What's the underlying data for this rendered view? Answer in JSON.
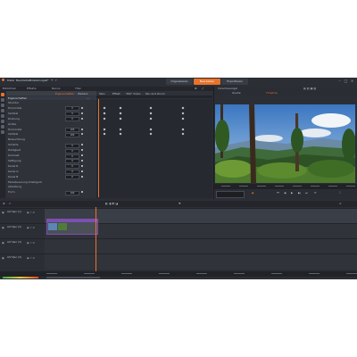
{
  "menu": [
    "Datei",
    "Bearbeiten",
    "Einstellungen"
  ],
  "modes": {
    "organize": "Organisieren",
    "edit": "Bearbeiten",
    "export": "Exportieren"
  },
  "toolbar": {
    "tabs": [
      "Bibliothek",
      "Effekte",
      "Nanos",
      "Titel"
    ]
  },
  "effects_panel": {
    "tabs": [
      "Eigenschaften",
      "Weitere Editor"
    ],
    "header": "Eigenschaften",
    "rows": [
      {
        "label": "Struktur"
      },
      {
        "label": "Horizontal",
        "value": "0"
      },
      {
        "label": "Vertikal",
        "value": "0"
      },
      {
        "label": "Drehung",
        "value": "0"
      },
      {
        "label": "Größe"
      },
      {
        "label": "Horizontal",
        "value": "100"
      },
      {
        "label": "Vertikal",
        "value": "100"
      },
      {
        "label": "Beleuchtung"
      },
      {
        "label": "Schärfe",
        "value": "0"
      },
      {
        "label": "Helligkeit",
        "value": "0"
      },
      {
        "label": "Kontrast",
        "value": "0"
      },
      {
        "label": "Sättigung",
        "value": "0"
      },
      {
        "label": "Kanal R",
        "value": "0"
      },
      {
        "label": "Kanal G",
        "value": "0"
      },
      {
        "label": "Kanal B",
        "value": "0"
      },
      {
        "label": "Farbsteuerung Intelligent"
      },
      {
        "label": "Abbildung"
      },
      {
        "label": "Form",
        "value": "100"
      }
    ]
  },
  "keyframes": {
    "columns": [
      "Tabs",
      "Effekt",
      "360° Video",
      "Pan and Zoom"
    ]
  },
  "preview": {
    "title": "Vorschauvogel",
    "tabs": [
      "Quelle",
      "Timeline"
    ]
  },
  "timeline": {
    "tracks": [
      {
        "label": "A/V Spur (1)"
      },
      {
        "label": "A/V Spur (2)"
      },
      {
        "label": "A/V Spur (3)"
      },
      {
        "label": "A/V Spur (4)"
      }
    ]
  },
  "colors": {
    "accent": "#e8732a",
    "background": "#2b2e35",
    "clip_border": "#7c4fb0"
  }
}
